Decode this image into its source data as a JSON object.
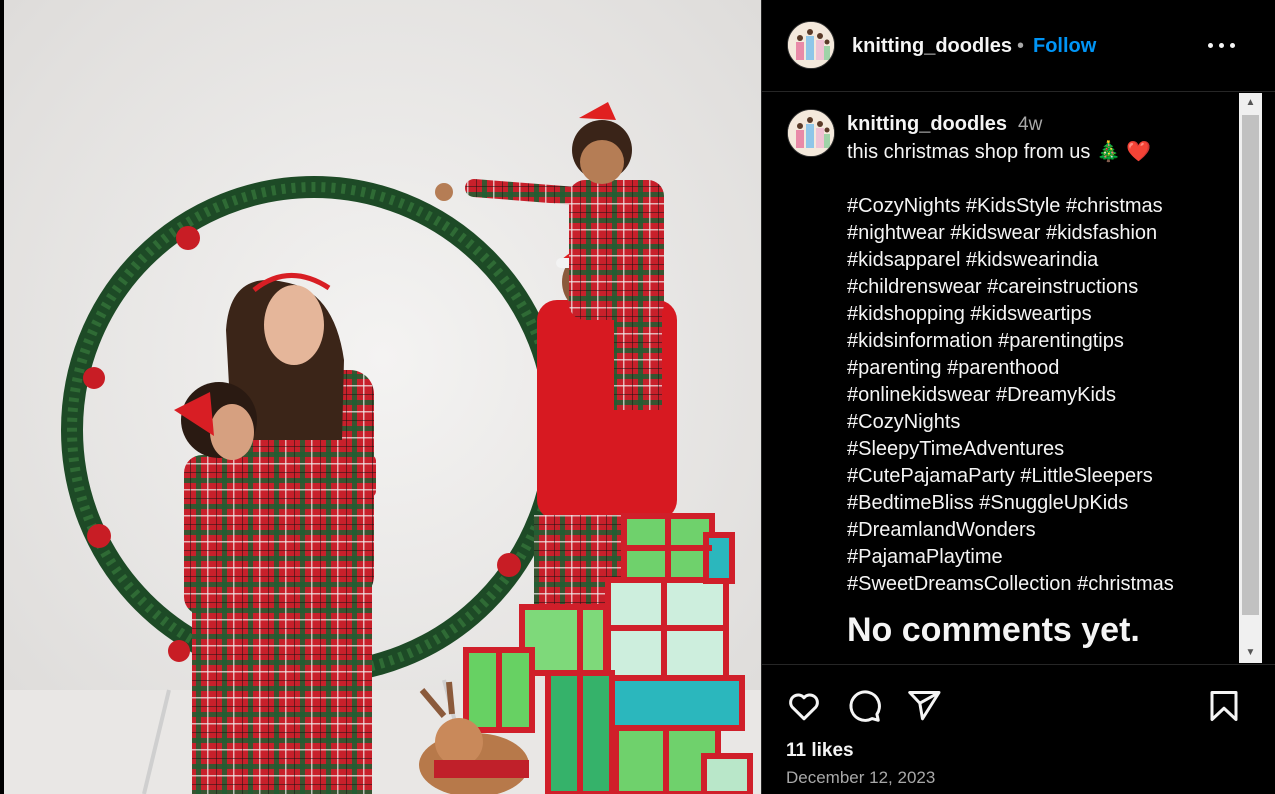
{
  "post": {
    "username": "knitting_doodles",
    "separator": "•",
    "follow_label": "Follow",
    "more_label": "More options",
    "avatar_icon": "family-avatar-icon"
  },
  "caption": {
    "username": "knitting_doodles",
    "time_ago": "4w",
    "text": "this christmas shop from us 🎄 ❤️\n\n#CozyNights #KidsStyle #christmas\n#nightwear #kidswear #kidsfashion\n#kidsapparel #kidswearindia\n#childrenswear #careinstructions\n#kidshopping #kidsweartips\n#kidsinformation #parentingtips\n#parenting #parenthood\n#onlinekidswear #DreamyKids\n#CozyNights\n#SleepyTimeAdventures\n#CutePajamaParty #LittleSleepers\n#BedtimeBliss #SnuggleUpKids\n#DreamlandWonders\n#PajamaPlaytime\n#SweetDreamsCollection #christmas"
  },
  "comments": {
    "empty_label": "No comments yet."
  },
  "actions": {
    "icons": [
      "heart-icon",
      "comment-icon",
      "share-icon",
      "bookmark-icon"
    ],
    "likes": "11 likes",
    "date": "December 12, 2023"
  },
  "colors": {
    "background": "#000000",
    "link": "#0095f6",
    "muted": "#a8a8a8",
    "plaid_red": "#c8202b"
  }
}
